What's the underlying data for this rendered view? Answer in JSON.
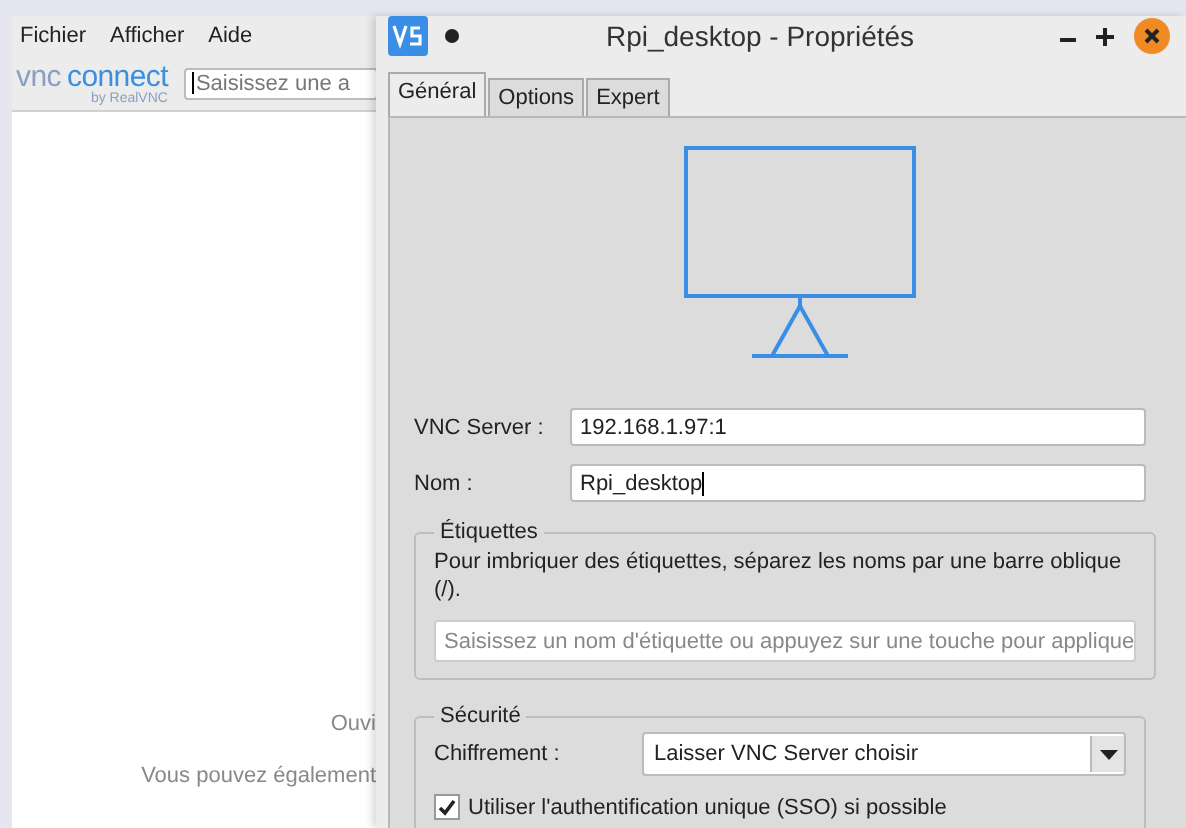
{
  "back_window": {
    "menu": [
      {
        "label": "Fichier"
      },
      {
        "label": "Afficher"
      },
      {
        "label": "Aide"
      }
    ],
    "logo": {
      "word_a": "vnc",
      "word_b": "connect",
      "byline": "by RealVNC"
    },
    "search": {
      "placeholder": "Saisissez une a"
    },
    "hints": [
      "Ouvi",
      "Vous pouvez également"
    ]
  },
  "dialog": {
    "title": "Rpi_desktop - Propriétés",
    "tabs": [
      {
        "label": "Général",
        "selected": true
      },
      {
        "label": "Options",
        "selected": false
      },
      {
        "label": "Expert",
        "selected": false
      }
    ],
    "fields": [
      {
        "label": "VNC Server :",
        "value": "192.168.1.97:1"
      },
      {
        "label": "Nom :",
        "value": "Rpi_desktop"
      }
    ],
    "labels_group": {
      "title": "Étiquettes",
      "description": "Pour imbriquer des étiquettes, séparez les noms par une barre oblique (/).",
      "placeholder": "Saisissez un nom d'étiquette ou appuyez sur une touche pour applique"
    },
    "security_group": {
      "title": "Sécurité",
      "encryption_label": "Chiffrement :",
      "encryption_value": "Laisser VNC Server choisir",
      "sso": {
        "label": "Utiliser l'authentification unique (SSO) si possible",
        "checked": true
      }
    }
  }
}
